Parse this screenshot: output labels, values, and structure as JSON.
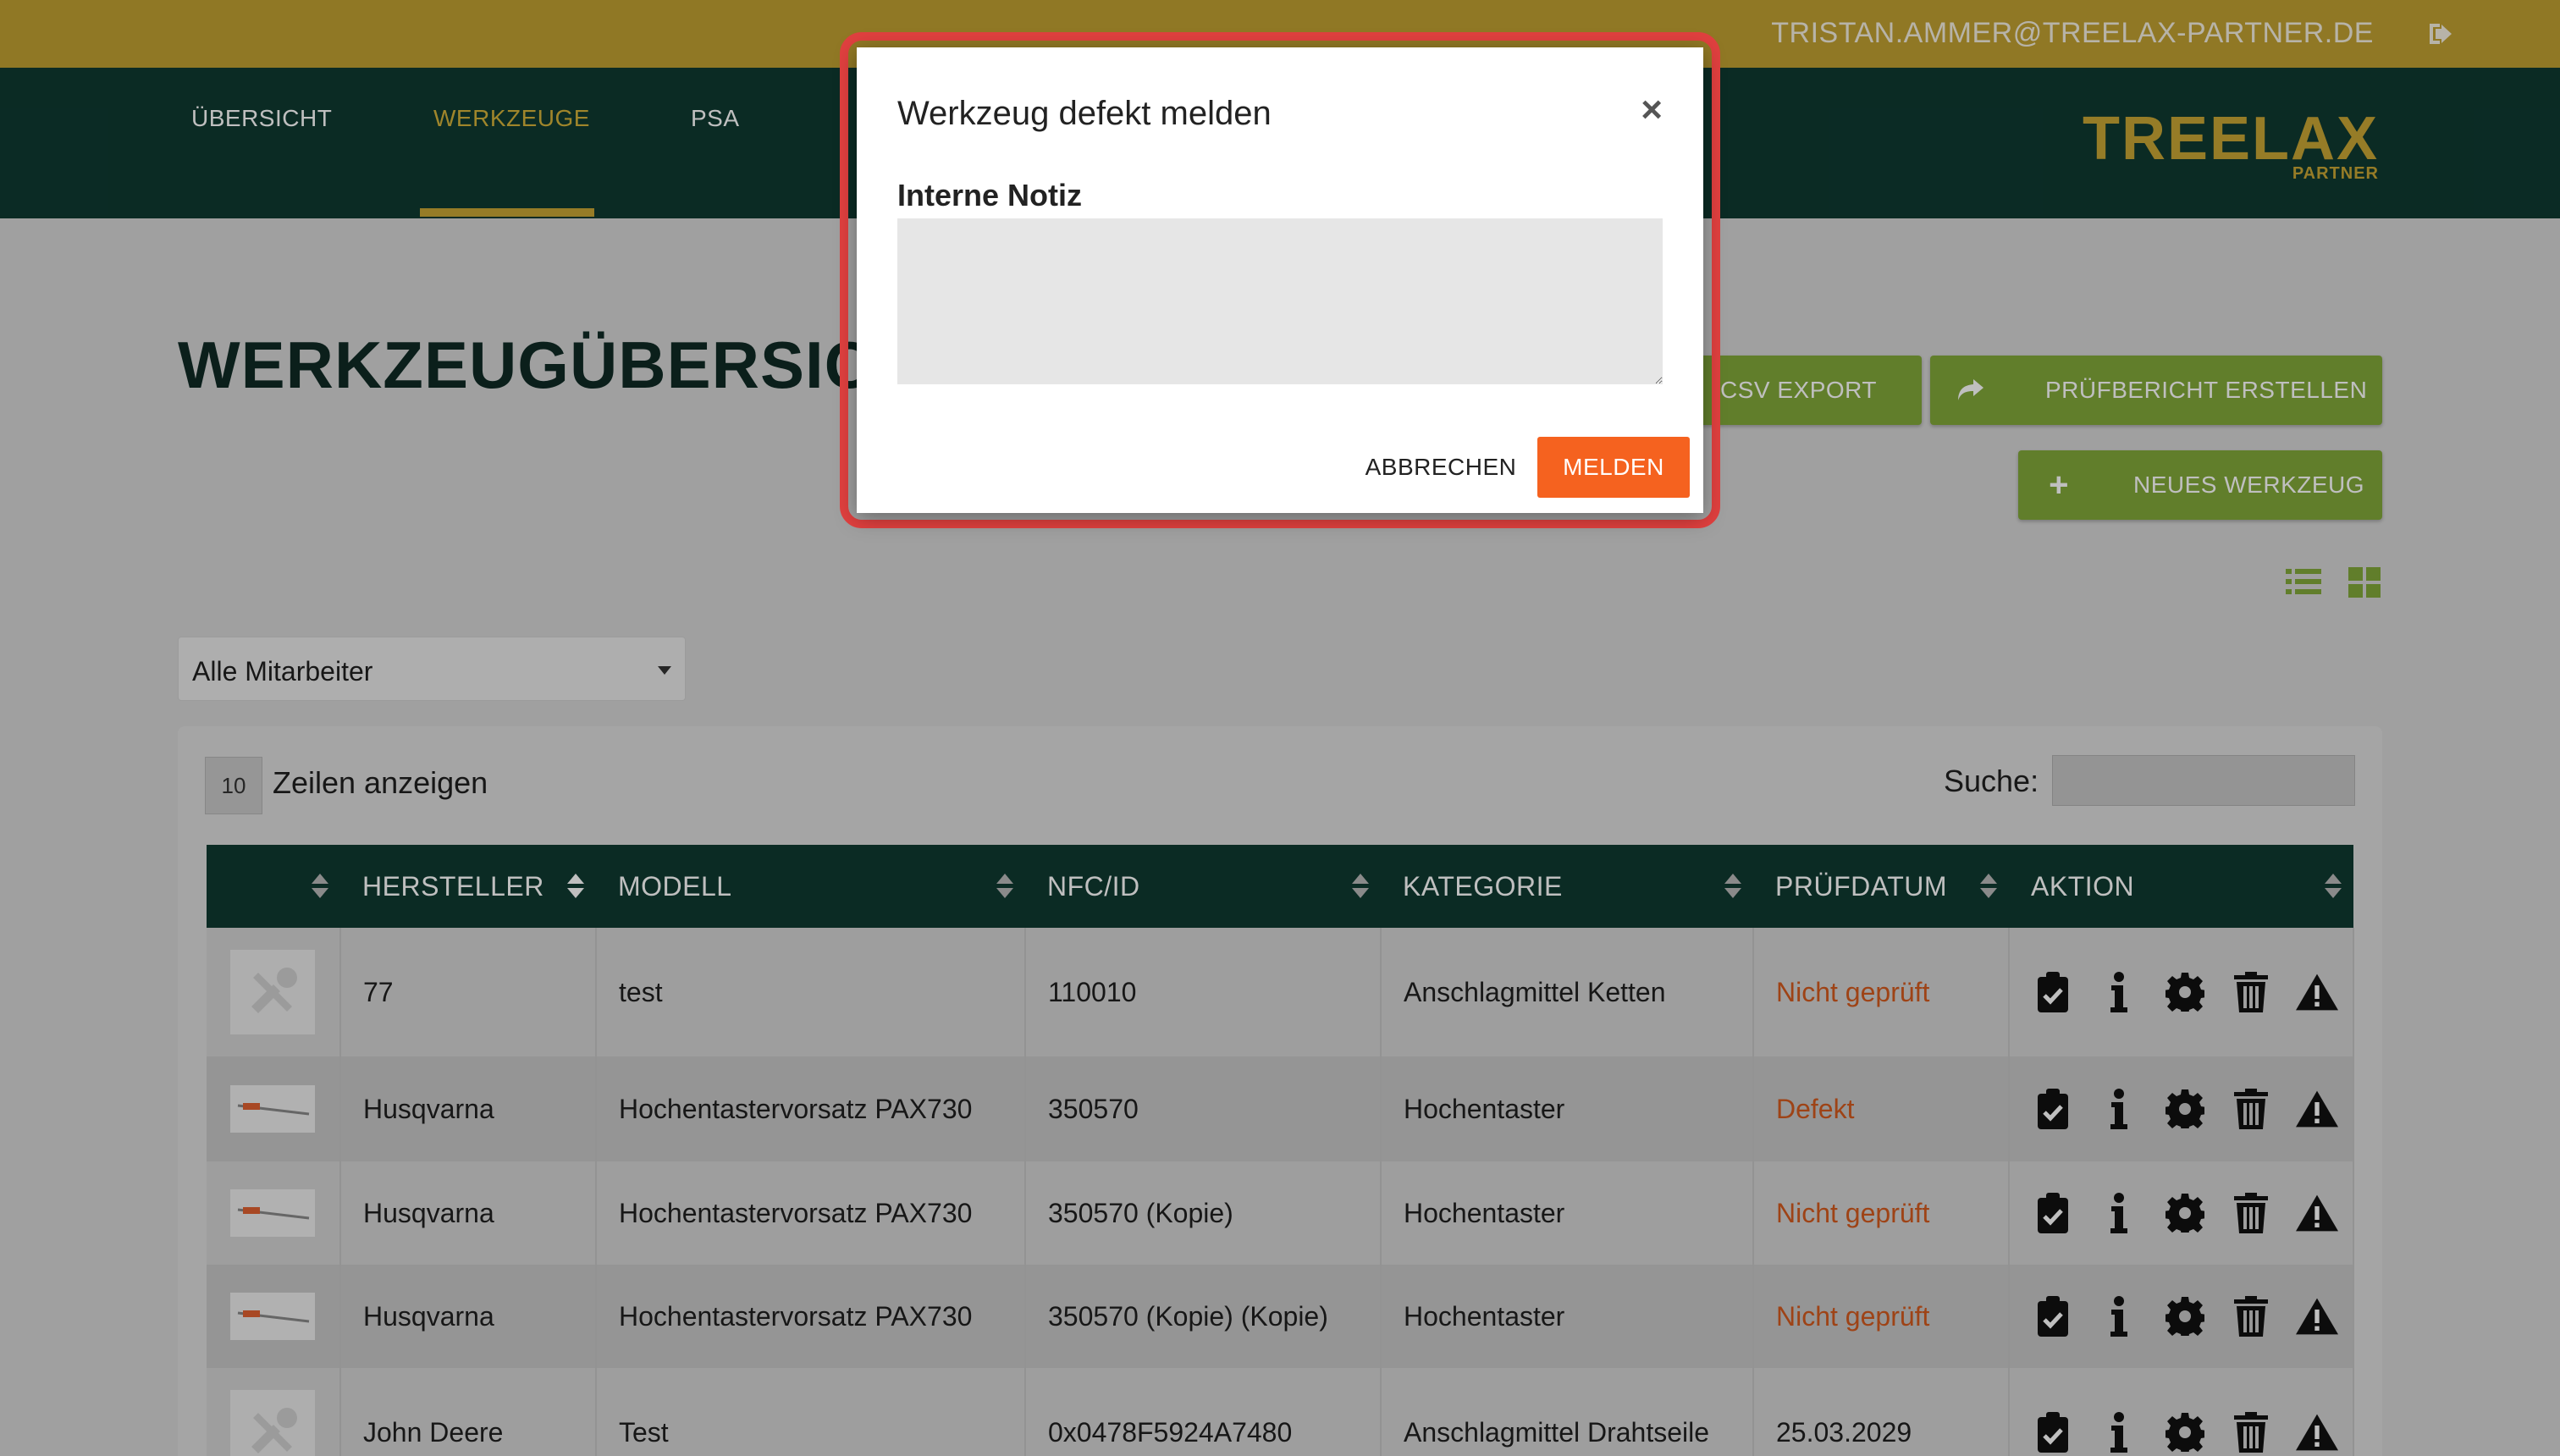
{
  "header": {
    "user_email": "TRISTAN.AMMER@TREELAX-PARTNER.DE",
    "logout_icon": "logout-icon"
  },
  "nav": {
    "items": [
      {
        "label": "ÜBERSICHT",
        "active": false
      },
      {
        "label": "WERKZEUGE",
        "active": true
      },
      {
        "label": "PSA",
        "active": false
      }
    ],
    "logo_brand": "TREELAX",
    "logo_sub": "PARTNER"
  },
  "page": {
    "title": "WERKZEUGÜBERSICHT",
    "csv_export": "CSV EXPORT",
    "report_button": "PRÜFBERICHT ERSTELLEN",
    "new_tool_button": "NEUES WERKZEUG",
    "employee_filter": "Alle Mitarbeiter"
  },
  "table_controls": {
    "rows_count": "10",
    "rows_label": "Zeilen anzeigen",
    "search_label": "Suche:",
    "search_value": ""
  },
  "table": {
    "columns": [
      "",
      "HERSTELLER",
      "MODELL",
      "NFC/ID",
      "KATEGORIE",
      "PRÜFDATUM",
      "AKTION"
    ],
    "rows": [
      {
        "hersteller": "77",
        "modell": "test",
        "nfc": "110010",
        "kategorie": "Anschlagmittel Ketten",
        "pruefdatum": "Nicht geprüft",
        "image": "tools-placeholder-icon"
      },
      {
        "hersteller": "Husqvarna",
        "modell": "Hochentastervorsatz PAX730",
        "nfc": "350570",
        "kategorie": "Hochentaster",
        "pruefdatum": "Defekt",
        "image": "pole-saw-image"
      },
      {
        "hersteller": "Husqvarna",
        "modell": "Hochentastervorsatz PAX730",
        "nfc": "350570 (Kopie)",
        "kategorie": "Hochentaster",
        "pruefdatum": "Nicht geprüft",
        "image": "pole-saw-image"
      },
      {
        "hersteller": "Husqvarna",
        "modell": "Hochentastervorsatz PAX730",
        "nfc": "350570 (Kopie) (Kopie)",
        "kategorie": "Hochentaster",
        "pruefdatum": "Nicht geprüft",
        "image": "pole-saw-image"
      },
      {
        "hersteller": "John Deere",
        "modell": "Test",
        "nfc": "0x0478F5924A7480",
        "kategorie": "Anschlagmittel Drahtseile",
        "pruefdatum": "25.03.2029",
        "image": "tools-placeholder-icon"
      }
    ],
    "action_icons": [
      "clipboard-check-icon",
      "info-icon",
      "gear-icon",
      "trash-icon",
      "warning-icon"
    ]
  },
  "modal": {
    "title": "Werkzeug defekt melden",
    "close_label": "×",
    "field_label": "Interne Notiz",
    "note_value": "",
    "cancel_label": "ABBRECHEN",
    "submit_label": "MELDEN"
  },
  "colors": {
    "topbar": "#c0a032",
    "navbar": "#0f3a31",
    "accent_gold": "#c9a634",
    "green_button": "#82a83a",
    "submit_orange": "#f5621f",
    "status_red": "#d35a1e",
    "highlight_red": "#e0403f"
  }
}
